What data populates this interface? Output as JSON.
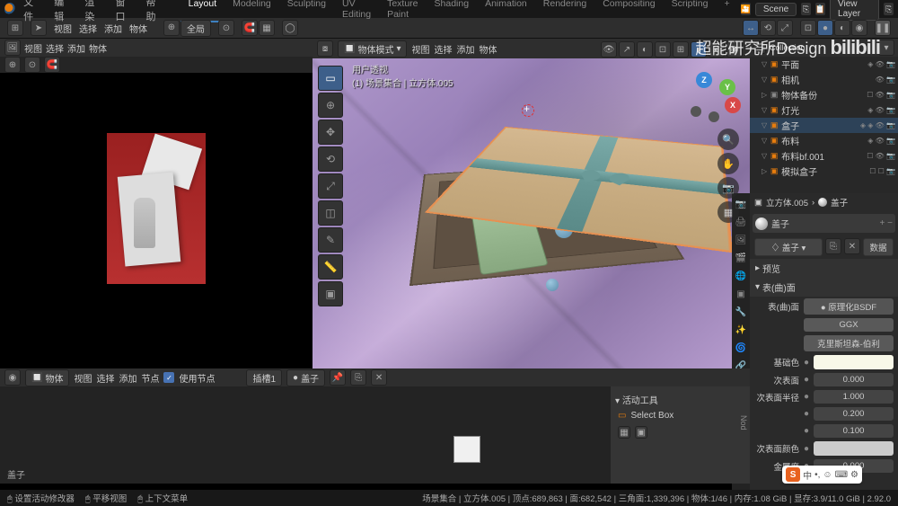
{
  "topmenu": [
    "文件",
    "编辑",
    "渲染",
    "窗口",
    "帮助"
  ],
  "tabs": [
    "Layout",
    "Modeling",
    "Sculpting",
    "UV Editing",
    "Texture Paint",
    "Shading",
    "Animation",
    "Rendering",
    "Compositing",
    "Scripting"
  ],
  "active_tab": "Layout",
  "scene_label": "Scene",
  "viewlayer_label": "View Layer",
  "header2": {
    "view": "视图",
    "select": "选择",
    "add": "添加",
    "object": "物体",
    "global": "全局"
  },
  "viewport": {
    "mode": "物体模式",
    "menus": [
      "视图",
      "选择",
      "添加",
      "物体"
    ],
    "info_line1": "用户透视",
    "info_line2": "(1) 场景集合 | 立方体.005"
  },
  "outliner": {
    "title": "Collection",
    "search_placeholder": "",
    "items": [
      {
        "indent": 1,
        "icon": "▽",
        "color": "#e87d0d",
        "name": "平面",
        "t": "◈ 👁 📷"
      },
      {
        "indent": 1,
        "icon": "▽",
        "color": "#e87d0d",
        "name": "相机",
        "t": "👁 📷"
      },
      {
        "indent": 1,
        "icon": "▷",
        "color": "#888",
        "name": "物体备份",
        "t": "☐ 👁 📷"
      },
      {
        "indent": 1,
        "icon": "▽",
        "color": "#e87d0d",
        "name": "灯光",
        "t": "◈ 👁 📷"
      },
      {
        "indent": 1,
        "icon": "▽",
        "color": "#e87d0d",
        "name": "盒子",
        "t": "◈ ◈ 👁 📷",
        "sel": true
      },
      {
        "indent": 1,
        "icon": "▽",
        "color": "#e87d0d",
        "name": "布料",
        "t": "◈ 👁 📷"
      },
      {
        "indent": 1,
        "icon": "▽",
        "color": "#e87d0d",
        "name": "布料bf.001",
        "t": "☐ 👁 📷"
      },
      {
        "indent": 1,
        "icon": "▷",
        "color": "#e87d0d",
        "name": "模拟盒子",
        "t": "☐ ☐ 📷"
      }
    ]
  },
  "props": {
    "object": "立方体.005",
    "material": "盖子",
    "mat_display": "盖子",
    "link_browse": "♢ 盖子 ▾",
    "link_data": "数据",
    "section_preview": "预览",
    "section_surface": "表(曲)面",
    "surface_label": "表(曲)面",
    "bsdf": "原理化BSDF",
    "dist": "GGX",
    "sss": "克里斯坦森-伯利",
    "rows": [
      {
        "l": "基础色",
        "type": "color"
      },
      {
        "l": "次表面",
        "v": "0.000"
      },
      {
        "l": "次表面半径",
        "v": "1.000"
      },
      {
        "l": "",
        "v": "0.200"
      },
      {
        "l": "",
        "v": "0.100"
      },
      {
        "l": "次表面颜色",
        "type": "color2"
      },
      {
        "l": "金属度",
        "v": "0.000"
      }
    ]
  },
  "bottom": {
    "menus": [
      "视图",
      "选择",
      "添加",
      "节点"
    ],
    "use_nodes": "使用节点",
    "object_mode": "物体",
    "slot": "插槽1",
    "material": "盖子",
    "active_tool": "活动工具",
    "select_box": "Select Box",
    "footer": "盖子",
    "status_left": [
      "设置活动修改器",
      "平移视图",
      "上下文菜单"
    ]
  },
  "statusbar": {
    "right": "场景集合 | 立方体.005 | 顶点:689,863 | 面:682,542 | 三角面:1,339,396 | 物体:1/46 | 内存:1.08 GiB | 显存:3.9/11.0 GiB | 2.92.0"
  },
  "watermark": "超能研究所Design"
}
